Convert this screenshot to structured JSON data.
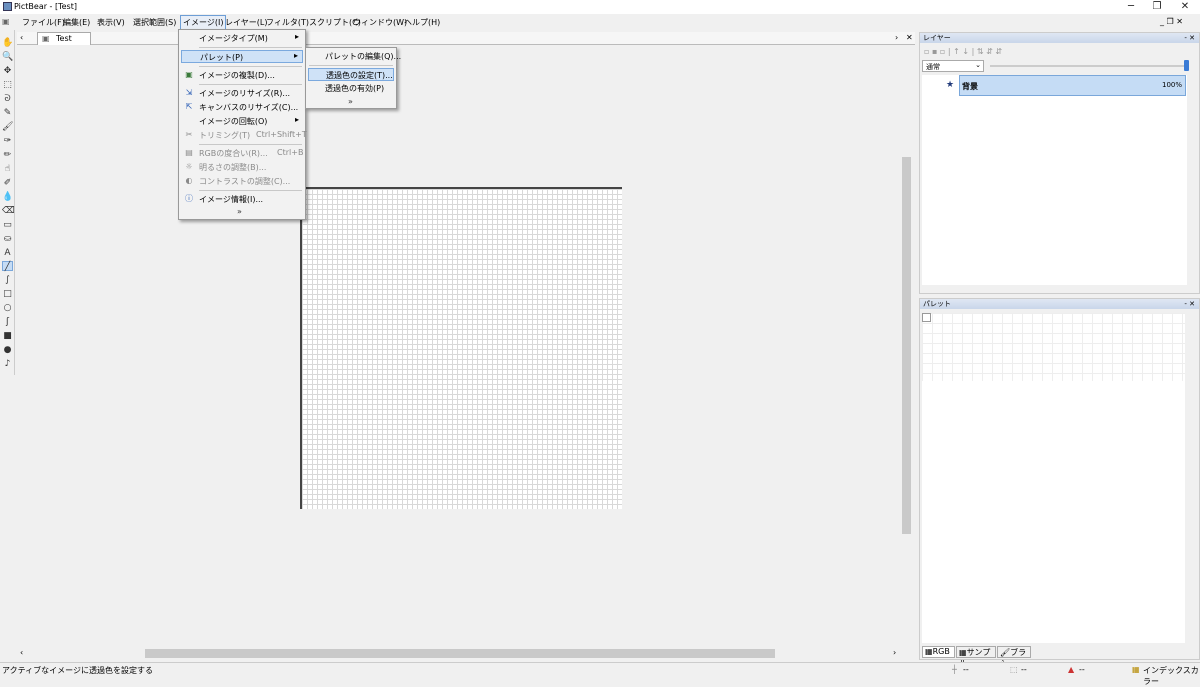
{
  "window": {
    "title": "PictBear - [Test]",
    "minimize": "─",
    "restore": "❐",
    "close": "✕"
  },
  "menubar": {
    "items": [
      "ファイル(F)",
      "編集(E)",
      "表示(V)",
      "選択範囲(S)",
      "イメージ(I)",
      "レイヤー(L)",
      "フィルタ(T)",
      "スクリプト(C)",
      "ウィンドウ(W)",
      "ヘルプ(H)"
    ],
    "active_index": 4,
    "mdi_controls": "_ ❐ ✕"
  },
  "doc_tab": {
    "label": "Test",
    "nav_left": "‹",
    "nav_right": "›",
    "close": "✕"
  },
  "image_menu": {
    "items": [
      {
        "label": "イメージタイプ(M)",
        "shortcut": "",
        "submenu": true,
        "disabled": false,
        "icon": ""
      },
      {
        "label": "パレット(P)",
        "shortcut": "",
        "submenu": true,
        "disabled": false,
        "highlighted": true,
        "icon": ""
      },
      {
        "label": "イメージの複製(D)...",
        "shortcut": "",
        "submenu": false,
        "disabled": false,
        "icon": "duplicate-icon"
      },
      {
        "label": "イメージのリサイズ(R)...",
        "shortcut": "",
        "submenu": false,
        "disabled": false,
        "icon": "resize-icon"
      },
      {
        "label": "キャンバスのリサイズ(C)...",
        "shortcut": "",
        "submenu": false,
        "disabled": false,
        "icon": "canvas-resize-icon"
      },
      {
        "label": "イメージの回転(O)",
        "shortcut": "",
        "submenu": true,
        "disabled": false,
        "icon": ""
      },
      {
        "label": "トリミング(T)",
        "shortcut": "Ctrl+Shift+T",
        "submenu": false,
        "disabled": true,
        "icon": "trim-icon"
      },
      {
        "label": "RGBの度合い(R)...",
        "shortcut": "Ctrl+B",
        "submenu": false,
        "disabled": true,
        "icon": "rgb-icon"
      },
      {
        "label": "明るさの調整(B)...",
        "shortcut": "",
        "submenu": false,
        "disabled": true,
        "icon": "brightness-icon"
      },
      {
        "label": "コントラストの調整(C)...",
        "shortcut": "",
        "submenu": false,
        "disabled": true,
        "icon": "contrast-icon"
      },
      {
        "label": "イメージ情報(I)...",
        "shortcut": "",
        "submenu": false,
        "disabled": false,
        "icon": "info-icon"
      }
    ],
    "more": "»"
  },
  "palette_submenu": {
    "items": [
      {
        "label": "パレットの編集(Q)...",
        "highlighted": false
      },
      {
        "label": "透過色の設定(T)...",
        "highlighted": true
      },
      {
        "label": "透過色の有効(P)",
        "highlighted": false
      }
    ],
    "more": "»"
  },
  "layer_panel": {
    "title": "レイヤー",
    "blend_mode": "通常",
    "opacity_label": "100%",
    "layers": [
      {
        "name": "背景",
        "opacity": "100%",
        "active_marker": "★"
      }
    ],
    "controls": "- ✕"
  },
  "palette_panel": {
    "title": "パレット",
    "tabs": [
      "RGB",
      "サンプル",
      "ブラシ"
    ],
    "controls": "- ✕"
  },
  "status": {
    "message": "アクティブなイメージに透過色を設定する",
    "field1": "--",
    "field2": "--",
    "field3": "--",
    "mode": "インデックスカラー"
  },
  "colors": {
    "highlight": "#cfe2f7",
    "highlight_border": "#7ba9de",
    "panel_title": "#c9d6ea",
    "layer_selected": "#c5dcf5"
  }
}
